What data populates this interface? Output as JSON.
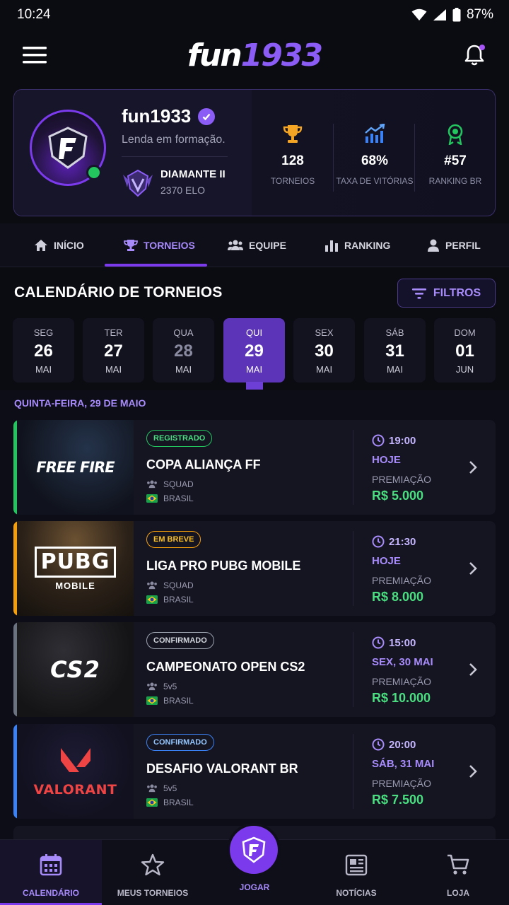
{
  "status_bar": {
    "time": "10:24",
    "battery": "87%"
  },
  "header": {
    "logo_part1": "fun",
    "logo_part2": "1933"
  },
  "profile": {
    "username": "fun1933",
    "tagline": "Lenda em formação.",
    "rank_name": "DIAMANTE II",
    "rank_elo": "2370 ELO",
    "stats": [
      {
        "icon": "trophy-icon",
        "value": "128",
        "label": "TORNEIOS"
      },
      {
        "icon": "chart-icon",
        "value": "68%",
        "label": "TAXA DE VITÓRIAS"
      },
      {
        "icon": "medal-icon",
        "value": "#57",
        "label": "RANKING BR"
      }
    ]
  },
  "tabs": [
    {
      "label": "INÍCIO",
      "icon": "home-icon"
    },
    {
      "label": "TORNEIOS",
      "icon": "trophy-icon",
      "active": true
    },
    {
      "label": "EQUIPE",
      "icon": "team-icon"
    },
    {
      "label": "RANKING",
      "icon": "bar-chart-icon"
    },
    {
      "label": "PERFIL",
      "icon": "user-icon"
    }
  ],
  "calendar": {
    "title": "CALENDÁRIO DE TORNEIOS",
    "filter_label": "FILTROS",
    "days": [
      {
        "weekday": "SEG",
        "day": "26",
        "month": "MAI"
      },
      {
        "weekday": "TER",
        "day": "27",
        "month": "MAI"
      },
      {
        "weekday": "QUA",
        "day": "28",
        "month": "MAI"
      },
      {
        "weekday": "QUI",
        "day": "29",
        "month": "MAI",
        "active": true
      },
      {
        "weekday": "SEX",
        "day": "30",
        "month": "MAI"
      },
      {
        "weekday": "SÁB",
        "day": "31",
        "month": "MAI"
      },
      {
        "weekday": "DOM",
        "day": "01",
        "month": "JUN"
      }
    ],
    "selected_date_label": "QUINTA-FEIRA, 29 DE MAIO"
  },
  "tournaments": [
    {
      "game": "FREE FIRE",
      "status": "REGISTRADO",
      "status_color": "#22c55e",
      "accent": "#22c55e",
      "name": "COPA ALIANÇA FF",
      "format": "SQUAD",
      "region": "BRASIL",
      "time": "19:00",
      "day": "HOJE",
      "prize_label": "PREMIAÇÃO",
      "prize": "R$ 5.000"
    },
    {
      "game_line1": "PUBG",
      "game_line2": "MOBILE",
      "status": "EM BREVE",
      "status_color": "#f59e0b",
      "accent": "#f59e0b",
      "name": "LIGA PRO PUBG MOBILE",
      "format": "SQUAD",
      "region": "BRASIL",
      "time": "21:30",
      "day": "HOJE",
      "prize_label": "PREMIAÇÃO",
      "prize": "R$ 8.000"
    },
    {
      "game": "CS2",
      "status": "CONFIRMADO",
      "status_color": "#9ca3af",
      "accent": "#6b7280",
      "name": "CAMPEONATO OPEN CS2",
      "format": "5v5",
      "region": "BRASIL",
      "time": "15:00",
      "day": "SEX, 30 MAI",
      "prize_label": "PREMIAÇÃO",
      "prize": "R$ 10.000"
    },
    {
      "game": "VALORANT",
      "status": "CONFIRMADO",
      "status_color": "#60a5fa",
      "accent": "#3b82f6",
      "name": "DESAFIO VALORANT BR",
      "format": "5v5",
      "region": "BRASIL",
      "time": "20:00",
      "day": "SÁB, 31 MAI",
      "prize_label": "PREMIAÇÃO",
      "prize": "R$ 7.500"
    }
  ],
  "bottom_nav": [
    {
      "label": "CALENDÁRIO",
      "icon": "calendar-icon",
      "active": true
    },
    {
      "label": "MEUS TORNEIOS",
      "icon": "star-icon"
    },
    {
      "label": "JOGAR",
      "icon": "play-logo-icon"
    },
    {
      "label": "NOTÍCIAS",
      "icon": "news-icon"
    },
    {
      "label": "LOJA",
      "icon": "cart-icon"
    }
  ],
  "colors": {
    "accent": "#7c3aed",
    "accent_light": "#a78bfa",
    "prize_green": "#4ade80",
    "background": "#0b0b12"
  }
}
